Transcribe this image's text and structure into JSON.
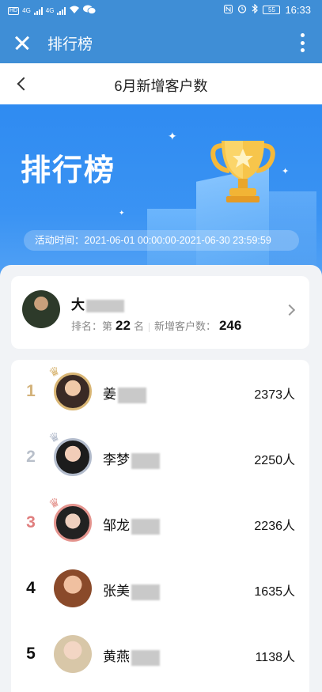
{
  "status_bar": {
    "time": "16:33",
    "battery": "55",
    "hd1": "HD",
    "hd2": "HD",
    "net1": "4G",
    "net2": "4G"
  },
  "app_bar": {
    "title": "排行榜"
  },
  "page": {
    "title": "6月新增客户数"
  },
  "banner": {
    "title": "排行榜",
    "activity_time": "活动时间：2021-06-01 00:00:00-2021-06-30 23:59:59"
  },
  "me": {
    "name": "大",
    "rank_prefix": "排名：第",
    "rank": "22",
    "rank_suffix": "名",
    "metric_label": "新增客户数：",
    "metric_value": "246"
  },
  "ranking": [
    {
      "rank": "1",
      "name": "姜",
      "value": "2373人",
      "color": "#d3b27a",
      "medal": "gold"
    },
    {
      "rank": "2",
      "name": "李梦",
      "value": "2250人",
      "color": "#b8bfca",
      "medal": "silver"
    },
    {
      "rank": "3",
      "name": "邹龙",
      "value": "2236人",
      "color": "#e07e7e",
      "medal": "bronze"
    },
    {
      "rank": "4",
      "name": "张美",
      "value": "1635人",
      "color": "#111111",
      "medal": "none"
    },
    {
      "rank": "5",
      "name": "黄燕",
      "value": "1138人",
      "color": "#111111",
      "medal": "none"
    }
  ]
}
